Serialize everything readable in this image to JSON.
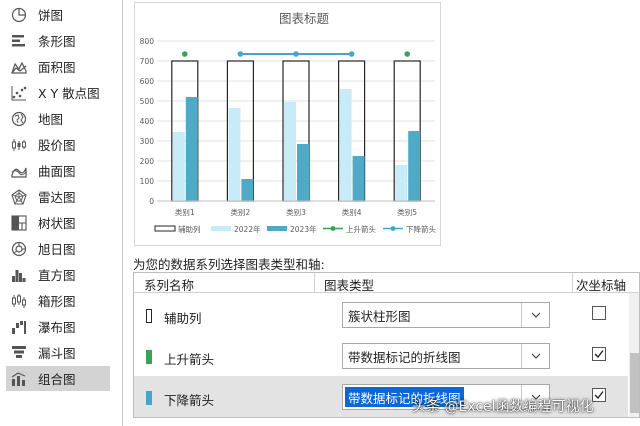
{
  "sidebar": {
    "items": [
      {
        "label": "饼图",
        "icon": "pie-chart-icon"
      },
      {
        "label": "条形图",
        "icon": "bar-chart-icon"
      },
      {
        "label": "面积图",
        "icon": "area-chart-icon"
      },
      {
        "label": "X Y 散点图",
        "icon": "scatter-chart-icon"
      },
      {
        "label": "地图",
        "icon": "map-chart-icon"
      },
      {
        "label": "股价图",
        "icon": "stock-chart-icon"
      },
      {
        "label": "曲面图",
        "icon": "surface-chart-icon"
      },
      {
        "label": "雷达图",
        "icon": "radar-chart-icon"
      },
      {
        "label": "树状图",
        "icon": "treemap-chart-icon"
      },
      {
        "label": "旭日图",
        "icon": "sunburst-chart-icon"
      },
      {
        "label": "直方图",
        "icon": "histogram-chart-icon"
      },
      {
        "label": "箱形图",
        "icon": "box-whisker-chart-icon"
      },
      {
        "label": "瀑布图",
        "icon": "waterfall-chart-icon"
      },
      {
        "label": "漏斗图",
        "icon": "funnel-chart-icon"
      },
      {
        "label": "组合图",
        "icon": "combo-chart-icon",
        "selected": true
      }
    ]
  },
  "chart_data": {
    "type": "bar",
    "title": "图表标题",
    "categories": [
      "类别1",
      "类别2",
      "类别3",
      "类别4",
      "类别5"
    ],
    "ylim": [
      0,
      800
    ],
    "yticks": [
      0,
      100,
      200,
      300,
      400,
      500,
      600,
      700,
      800
    ],
    "grid": true,
    "legend_position": "bottom",
    "series": [
      {
        "name": "辅助列",
        "kind": "column",
        "values": [
          700,
          700,
          700,
          700,
          700
        ],
        "color": "#ffffff",
        "stroke": "#262626"
      },
      {
        "name": "2022年",
        "kind": "column",
        "values": [
          345,
          465,
          495,
          560,
          180
        ],
        "color": "#c7ecf8"
      },
      {
        "name": "2023年",
        "kind": "column",
        "values": [
          520,
          110,
          285,
          225,
          350
        ],
        "color": "#4eaac6"
      },
      {
        "name": "上升箭头",
        "kind": "line-markers",
        "values": [
          735,
          null,
          null,
          null,
          735
        ],
        "color": "#3aa157"
      },
      {
        "name": "下降箭头",
        "kind": "line-markers",
        "values": [
          null,
          735,
          735,
          735,
          null
        ],
        "color": "#42a7c9"
      }
    ]
  },
  "table": {
    "instruction": "为您的数据系列选择图表类型和轴:",
    "headers": {
      "series_name": "系列名称",
      "chart_type": "图表类型",
      "secondary_axis": "次坐标轴"
    },
    "rows": [
      {
        "name": "辅助列",
        "type": "簇状柱形图",
        "secondary": false,
        "swatch": "#ffffff",
        "swatch_border": "#262626",
        "selected": false
      },
      {
        "name": "上升箭头",
        "type": "带数据标记的折线图",
        "secondary": true,
        "swatch": "#3aa157",
        "swatch_border": "#3aa157",
        "selected": false
      },
      {
        "name": "下降箭头",
        "type": "带数据标记的折线图",
        "secondary": true,
        "swatch": "#42a7c9",
        "swatch_border": "#42a7c9",
        "selected": true
      }
    ]
  },
  "watermark": "头条 @Excel函数编程可视化"
}
